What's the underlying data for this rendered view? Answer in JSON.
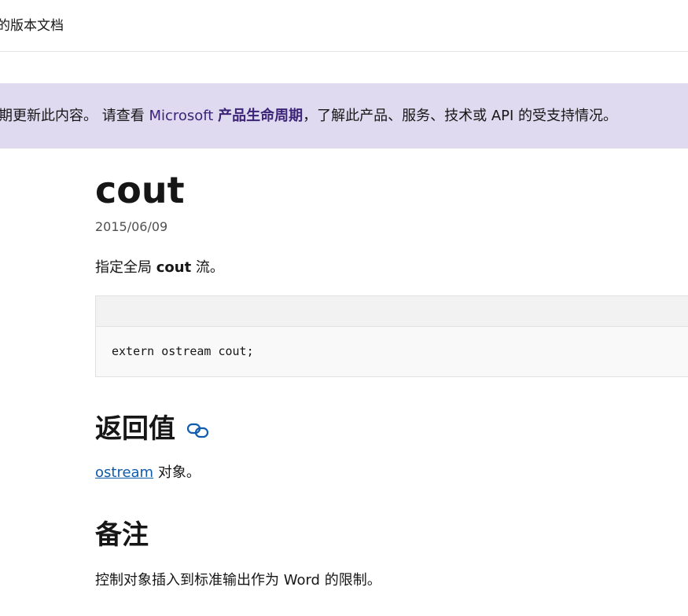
{
  "topbar": {
    "text": "的版本文档"
  },
  "banner": {
    "prefix": "期更新此内容。 请查看 ",
    "link_brand": "Microsoft",
    "link_strong": "产品生命周期",
    "suffix": "，了解此产品、服务、技术或 API 的受支持情况。"
  },
  "article": {
    "title": "cout",
    "date": "2015/06/09",
    "desc_prefix": "指定全局 ",
    "desc_strong": "cout",
    "desc_suffix": " 流。",
    "code": "extern ostream cout;",
    "section_return": {
      "heading": "返回值",
      "link_text": "ostream",
      "text_suffix": " 对象。"
    },
    "section_remarks": {
      "heading": "备注",
      "text": "控制对象插入到标准输出作为 Word 的限制。"
    }
  },
  "colors": {
    "banner_bg": "#e0daf0",
    "banner_link": "#3b2477",
    "link": "#0f5cad",
    "code_header": "#f2f2f2",
    "code_bg": "#f9f9f9"
  },
  "icons": {
    "heading_anchor": "link-icon"
  }
}
